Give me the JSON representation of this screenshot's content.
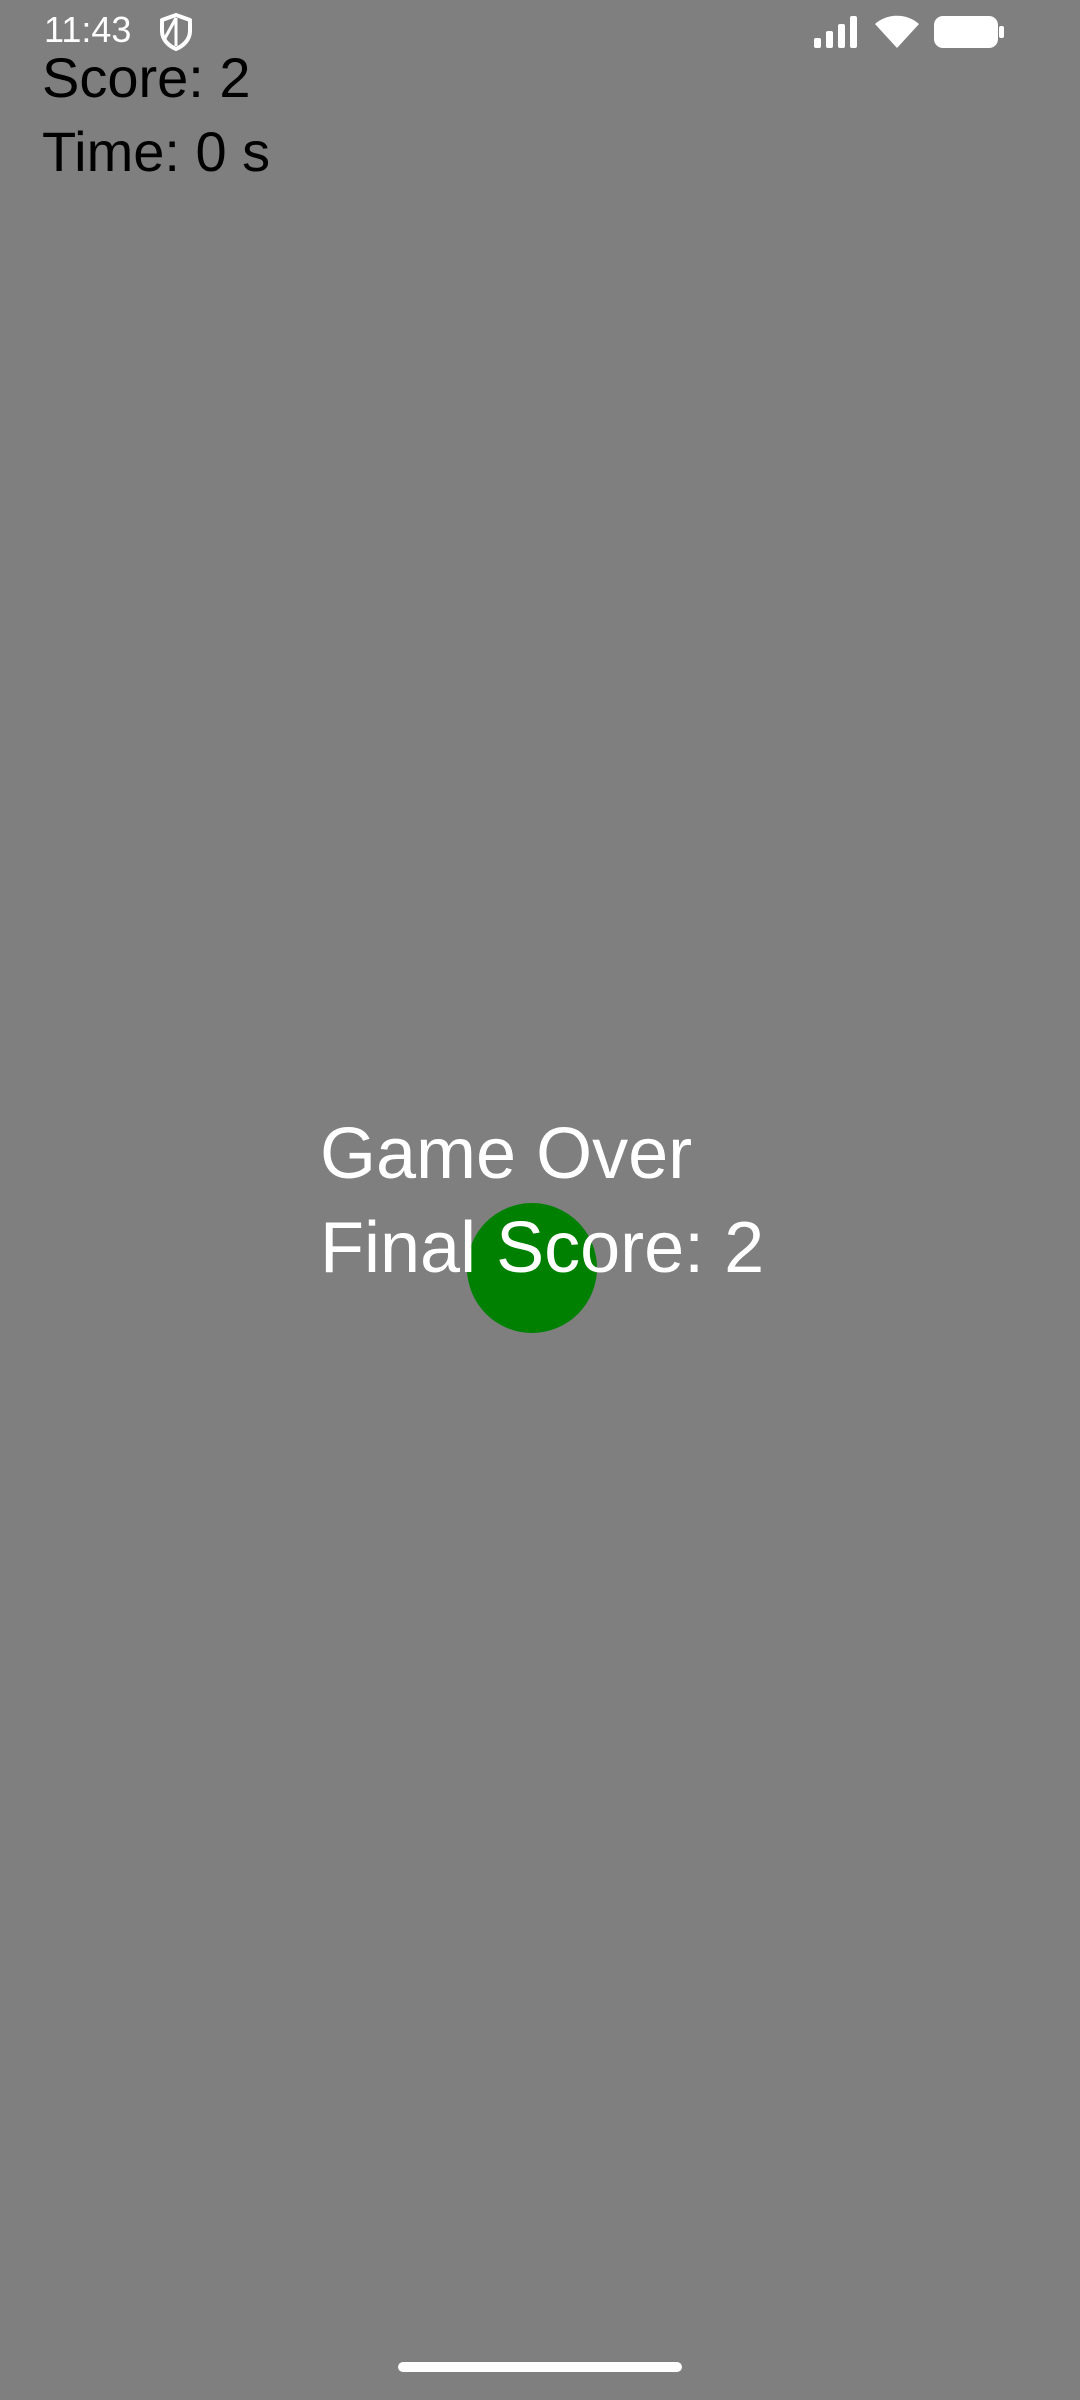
{
  "status_bar": {
    "time": "11:43",
    "icons": [
      "shield-icon",
      "signal-icon",
      "wifi-icon",
      "battery-icon"
    ]
  },
  "hud": {
    "score": "Score: 2",
    "time": "Time: 0 s"
  },
  "game_over": {
    "title": "Game Over",
    "final_score": "Final Score: 2"
  },
  "colors": {
    "background": "#7f7f7f",
    "ball": "#008000",
    "overlay_text": "#ffffff",
    "hud_text": "#000000"
  }
}
